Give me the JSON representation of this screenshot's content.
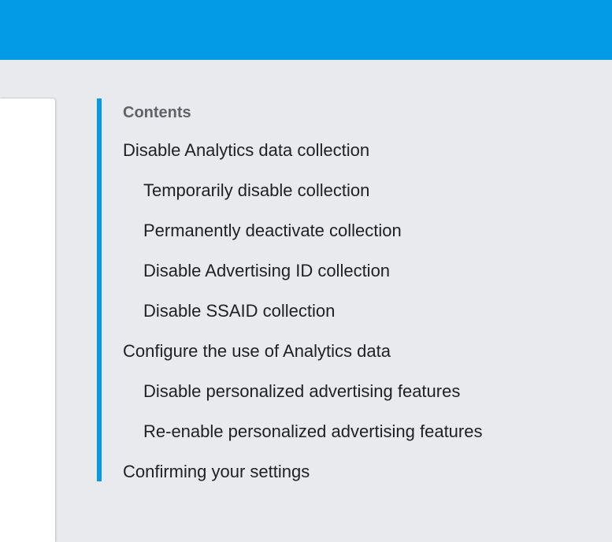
{
  "colors": {
    "accent": "#039be5",
    "background": "#e8eaed",
    "card": "#ffffff",
    "heading": "#5f6368",
    "text": "#202124"
  },
  "toc": {
    "title": "Contents",
    "items": [
      {
        "label": "Disable Analytics data collection",
        "level": 1
      },
      {
        "label": "Temporarily disable collection",
        "level": 2
      },
      {
        "label": "Permanently deactivate collection",
        "level": 2
      },
      {
        "label": "Disable Advertising ID collection",
        "level": 2
      },
      {
        "label": "Disable SSAID collection",
        "level": 2
      },
      {
        "label": "Configure the use of Analytics data",
        "level": 1
      },
      {
        "label": "Disable personalized advertising features",
        "level": 2
      },
      {
        "label": "Re-enable personalized advertising features",
        "level": 2
      },
      {
        "label": "Confirming your settings",
        "level": 1
      }
    ]
  }
}
